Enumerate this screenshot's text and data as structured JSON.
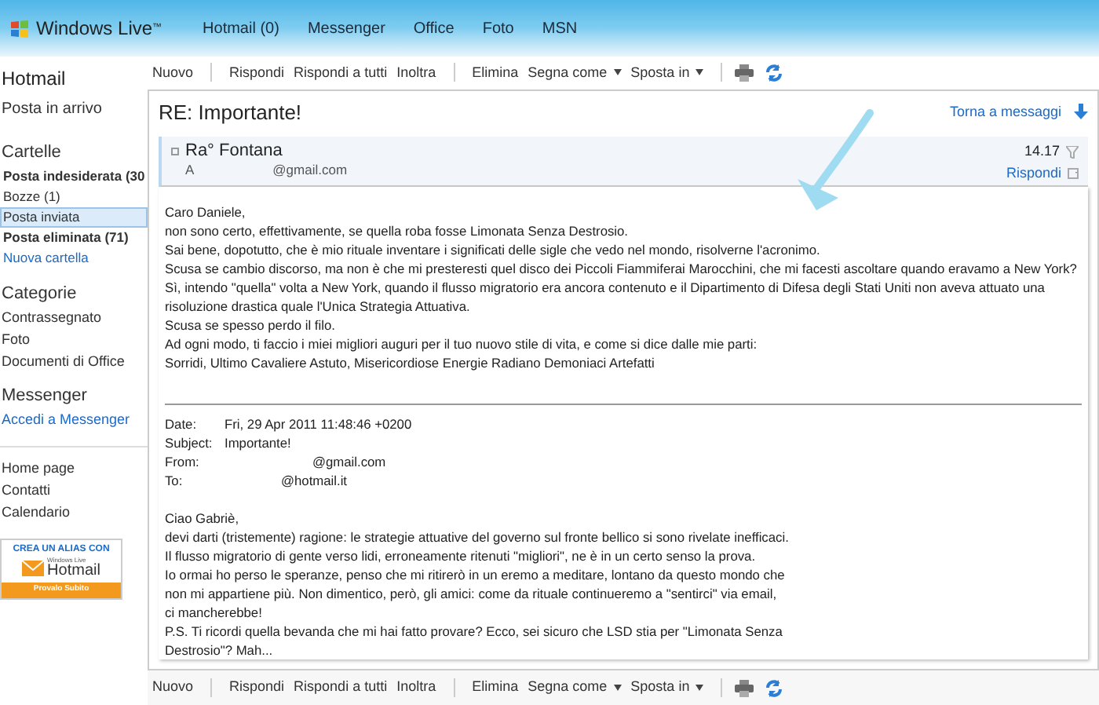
{
  "topbar": {
    "brand": "Windows Live",
    "brand_mark": "™",
    "nav": [
      "Hotmail (0)",
      "Messenger",
      "Office",
      "Foto",
      "MSN"
    ]
  },
  "sidebar": {
    "title": "Hotmail",
    "inbox": "Posta in arrivo",
    "folders_heading": "Cartelle",
    "folders": [
      {
        "label": "Posta indesiderata (30",
        "bold": true,
        "selected": false,
        "kind": "folder"
      },
      {
        "label": "Bozze (1)",
        "bold": false,
        "selected": false,
        "kind": "folder"
      },
      {
        "label": "Posta inviata",
        "bold": false,
        "selected": true,
        "kind": "folder"
      },
      {
        "label": "Posta eliminata (71)",
        "bold": true,
        "selected": false,
        "kind": "folder"
      },
      {
        "label": "Nuova cartella",
        "bold": false,
        "selected": false,
        "kind": "link"
      }
    ],
    "categories_heading": "Categorie",
    "categories": [
      "Contrassegnato",
      "Foto",
      "Documenti di Office"
    ],
    "messenger_heading": "Messenger",
    "messenger_link": "Accedi a Messenger",
    "links": [
      "Home page",
      "Contatti",
      "Calendario"
    ],
    "ad": {
      "headline": "CREA UN ALIAS CON",
      "logo_small": "Windows Live",
      "logo": "Hotmail",
      "cta": "Provalo Subito"
    }
  },
  "toolbar": {
    "groups": [
      [
        {
          "label": "Nuovo",
          "dropdown": false
        }
      ],
      [
        {
          "label": "Rispondi",
          "dropdown": false
        },
        {
          "label": "Rispondi a tutti",
          "dropdown": false
        },
        {
          "label": "Inoltra",
          "dropdown": false
        }
      ],
      [
        {
          "label": "Elimina",
          "dropdown": false
        },
        {
          "label": "Segna come",
          "dropdown": true
        },
        {
          "label": "Sposta in",
          "dropdown": true
        }
      ]
    ]
  },
  "bottom_toolbar": {
    "groups": [
      [
        {
          "label": "Nuovo",
          "dropdown": false
        }
      ],
      [
        {
          "label": "Rispondi",
          "dropdown": false
        },
        {
          "label": "Rispondi a tutti",
          "dropdown": false
        },
        {
          "label": "Inoltra",
          "dropdown": false
        }
      ],
      [
        {
          "label": "Elimina",
          "dropdown": false
        },
        {
          "label": "Segna come",
          "dropdown": true
        },
        {
          "label": "Sposta in",
          "dropdown": true
        }
      ]
    ]
  },
  "message": {
    "subject": "RE: Importante!",
    "back_link": "Torna a messaggi",
    "sender": "Ra° Fontana",
    "to_prefix": "A",
    "to_address": "@gmail.com",
    "time": "14.17",
    "reply": "Rispondi",
    "body": [
      "Caro Daniele,",
      "non sono certo, effettivamente, se quella roba fosse Limonata Senza Destrosio.",
      "Sai bene, dopotutto, che è mio rituale inventare i significati delle sigle che vedo nel mondo, risolverne l'acronimo.",
      "Scusa se cambio discorso, ma non è che mi presteresti quel disco dei Piccoli Fiammiferai Marocchini, che mi facesti ascoltare quando eravamo a New York?",
      "Sì, intendo \"quella\" volta a New York, quando il flusso migratorio era ancora contenuto e il Dipartimento di Difesa degli Stati Uniti non aveva attuato una",
      "risoluzione drastica quale l'Unica Strategia Attuativa.",
      "Scusa se spesso perdo il filo.",
      "Ad ogni modo, ti faccio i miei migliori auguri per il tuo nuovo stile di vita, e come si dice dalle mie parti:",
      "Sorridi, Ultimo Cavaliere Astuto, Misericordiose Energie Radiano Demoniaci Artefatti"
    ],
    "quoted_headers": [
      {
        "label": "Date:",
        "value": "Fri, 29 Apr 2011 11:48:46 +0200"
      },
      {
        "label": "Subject:",
        "value": "Importante!"
      },
      {
        "label": "From:",
        "value": "@gmail.com"
      },
      {
        "label": "To:",
        "value": "@hotmail.it"
      }
    ],
    "quoted_body": [
      "Ciao Gabriè,",
      "devi darti (tristemente) ragione: le strategie attuative del governo sul fronte bellico si sono rivelate inefficaci.",
      "Il flusso migratorio di gente verso lidi, erroneamente ritenuti \"migliori\", ne è in un certo senso la prova.",
      "Io ormai ho perso le speranze, penso che mi ritirerò in un eremo a meditare, lontano da questo mondo che",
      "non mi appartiene più. Non dimentico, però, gli amici: come da rituale continueremo a \"sentirci\" via email,",
      "ci mancherebbe!",
      "P.S. Ti ricordi quella bevanda che mi hai fatto provare? Ecco, sei sicuro che LSD stia per \"Limonata Senza",
      "Destrosio\"? Mah..."
    ]
  }
}
